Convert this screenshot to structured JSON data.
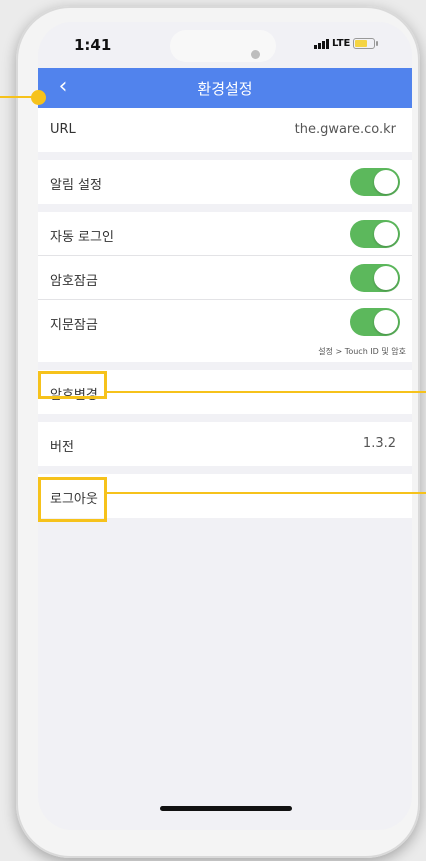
{
  "status_bar": {
    "time": "1:41",
    "network": "LTE",
    "icons": [
      "signal-icon",
      "battery-icon"
    ]
  },
  "navbar": {
    "title": "환경설정",
    "back_icon": "chevron-left-icon",
    "back_glyph": "‹"
  },
  "settings": {
    "url": {
      "label": "URL",
      "value": "the.gware.co.kr"
    },
    "notification": {
      "label": "알림 설정",
      "on": true
    },
    "auto_login": {
      "label": "자동 로그인",
      "on": true
    },
    "password_lock": {
      "label": "암호잠금",
      "on": true
    },
    "fingerprint_lock": {
      "label": "지문잠금",
      "on": true,
      "hint": "설정 > Touch ID 및 암호"
    },
    "change_password": {
      "label": "암호변경"
    },
    "version": {
      "label": "버전",
      "value": "1.3.2"
    },
    "logout": {
      "label": "로그아웃"
    }
  },
  "colors": {
    "navbar": "#5183ed",
    "toggle_on": "#5cb85c",
    "highlight": "#f6c21b",
    "background": "#f1f1f5"
  }
}
